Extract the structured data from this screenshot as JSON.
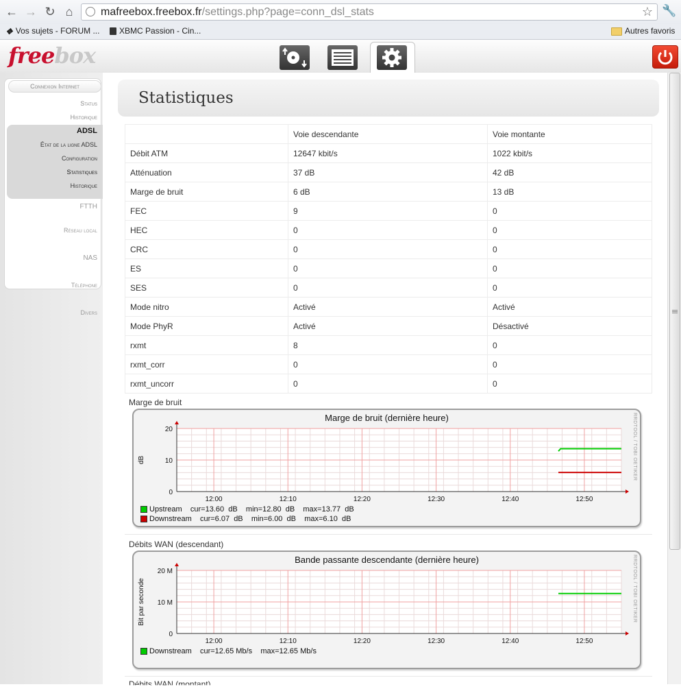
{
  "browser": {
    "url_host": "mafreebox.freebox.fr",
    "url_path": "/settings.php?page=conn_dsl_stats",
    "bookmarks": [
      "Vos sujets - FORUM ...",
      "XBMC Passion - Cin...",
      "Autres favoris"
    ]
  },
  "brand": {
    "logo_part1": "free",
    "logo_part2": "box",
    "accent": "#c8102e"
  },
  "sidebar": {
    "connexion": "Connexion Internet",
    "status": "Status",
    "historique1": "Historique",
    "adsl": "ADSL",
    "etat": "État de la ligne ADSL",
    "configuration": "Configuration",
    "statistiques": "Statistiques",
    "historique2": "Historique",
    "ftth": "FTTH",
    "reseau": "Réseau local",
    "nas": "NAS",
    "telephone": "Téléphone",
    "divers": "Divers"
  },
  "page": {
    "title": "Statistiques"
  },
  "stats_table": {
    "headers": [
      "",
      "Voie descendante",
      "Voie montante"
    ],
    "rows": [
      [
        "Débit ATM",
        "12647 kbit/s",
        "1022 kbit/s"
      ],
      [
        "Atténuation",
        "37 dB",
        "42 dB"
      ],
      [
        "Marge de bruit",
        "6 dB",
        "13 dB"
      ],
      [
        "FEC",
        "9",
        "0"
      ],
      [
        "HEC",
        "0",
        "0"
      ],
      [
        "CRC",
        "0",
        "0"
      ],
      [
        "ES",
        "0",
        "0"
      ],
      [
        "SES",
        "0",
        "0"
      ],
      [
        "Mode nitro",
        "Activé",
        "Activé"
      ],
      [
        "Mode PhyR",
        "Activé",
        "Désactivé"
      ],
      [
        "rxmt",
        "8",
        "0"
      ],
      [
        "rxmt_corr",
        "0",
        "0"
      ],
      [
        "rxmt_uncorr",
        "0",
        "0"
      ]
    ]
  },
  "graph1": {
    "label": "Marge de bruit",
    "title": "Marge de bruit (dernière heure)",
    "ylabel": "dB",
    "watermark": "RRDTOOL / TOBI OETIKER",
    "legend1": "Upstream    cur=13.60  dB    min=12.80  dB    max=13.77  dB",
    "legend2": "Downstream    cur=6.07  dB    min=6.00  dB    max=6.10  dB"
  },
  "graph2": {
    "label": "Débits WAN (descendant)",
    "title": "Bande passante descendante (dernière heure)",
    "ylabel": "Bit par seconde",
    "watermark": "RRDTOOL / TOBI OETIKER",
    "legend1": "Downstream    cur=12.65 Mb/s    max=12.65 Mb/s"
  },
  "graph3": {
    "label": "Débits WAN (montant)"
  },
  "chart_data": [
    {
      "type": "line",
      "title": "Marge de bruit (dernière heure)",
      "ylabel": "dB",
      "ylim": [
        0,
        20
      ],
      "yticks": [
        0,
        10,
        20
      ],
      "ytick_labels": [
        "0",
        "10",
        "20"
      ],
      "xticks": [
        "12:00",
        "12:10",
        "12:20",
        "12:30",
        "12:40",
        "12:50"
      ],
      "grid": true,
      "series": [
        {
          "name": "Upstream",
          "color": "#00cc00",
          "x": [
            46.5,
            46.8,
            50,
            55
          ],
          "values": [
            12.8,
            13.6,
            13.6,
            13.6
          ]
        },
        {
          "name": "Downstream",
          "color": "#cc0000",
          "x": [
            46.5,
            50,
            55
          ],
          "values": [
            6.07,
            6.07,
            6.07
          ]
        }
      ]
    },
    {
      "type": "line",
      "title": "Bande passante descendante (dernière heure)",
      "ylabel": "Bit par seconde",
      "ylim": [
        0,
        20000000
      ],
      "yticks": [
        0,
        10000000,
        20000000
      ],
      "ytick_labels": [
        "0",
        "10 M",
        "20 M"
      ],
      "xticks": [
        "12:00",
        "12:10",
        "12:20",
        "12:30",
        "12:40",
        "12:50"
      ],
      "grid": true,
      "series": [
        {
          "name": "Downstream",
          "color": "#00cc00",
          "x": [
            46.5,
            55
          ],
          "values": [
            12650000,
            12650000
          ]
        }
      ]
    }
  ]
}
